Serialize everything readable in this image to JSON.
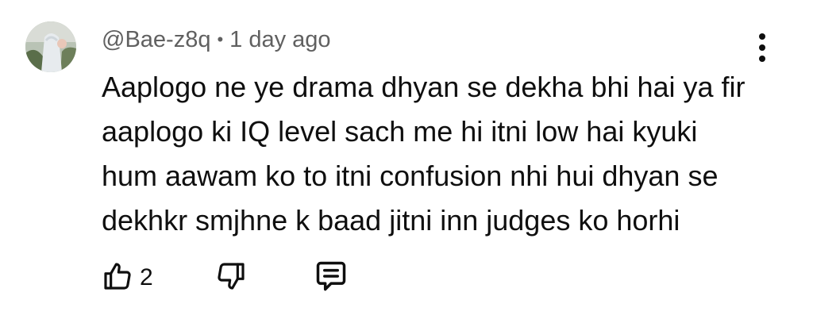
{
  "comment": {
    "author": "@Bae-z8q",
    "separator": "•",
    "time": "1 day ago",
    "text_lines": [
      "Aaplogo ne ye drama dhyan se dekha bhi hai ya fir",
      "aaplogo ki IQ level sach me hi itni low hai kyuki",
      "hum aawam ko to itni confusion nhi hui dhyan se",
      "dekhkr smjhne k baad jitni inn judges ko horhi"
    ],
    "likes": "2"
  },
  "icons": {
    "avatar": "avatar",
    "menu": "more-vertical-icon",
    "like": "thumbs-up-icon",
    "dislike": "thumbs-down-icon",
    "reply": "reply-comment-icon"
  }
}
